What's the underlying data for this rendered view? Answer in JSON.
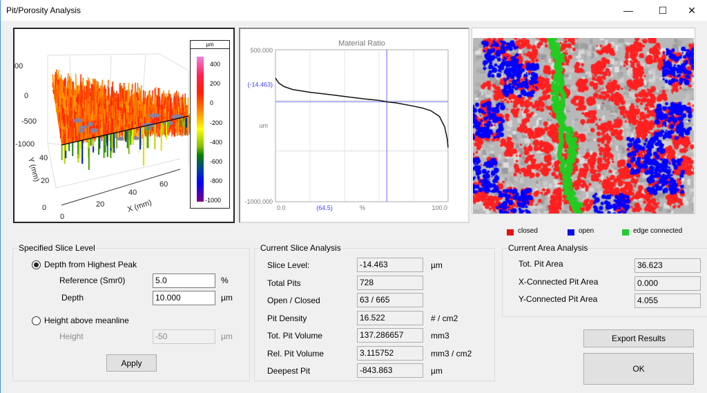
{
  "window": {
    "title": "Pit/Porosity Analysis",
    "minimize": "—",
    "maximize": "☐",
    "close": "✕"
  },
  "surface3d": {
    "colorbar_unit": "µm",
    "colorbar_ticks": [
      "400",
      "200",
      "0",
      "-200",
      "-400",
      "-600",
      "-800",
      "-1000"
    ],
    "z_ticks": [
      "00",
      "0",
      "-500",
      "-1000"
    ],
    "y_ticks": [
      "40",
      "20",
      "0"
    ],
    "x_ticks": [
      "0",
      "20",
      "40",
      "60"
    ],
    "x_label": "X (mm)",
    "y_label": "Y (mm)"
  },
  "chart_data": {
    "type": "line",
    "title": "Material Ratio",
    "xlabel": "%",
    "ylabel": "um",
    "xlim": [
      0,
      100
    ],
    "ylim": [
      -1000,
      500
    ],
    "x_tick_labels": [
      "0.0",
      "100.0"
    ],
    "y_tick_labels": [
      "500.000",
      "-1000.000"
    ],
    "grid": true,
    "slice_level_label": "(-14.463)",
    "slice_level": -14.463,
    "ratio_marker_label": "(64.5)",
    "ratio_marker": 64.5,
    "series": [
      {
        "x": [
          0,
          2,
          5,
          10,
          20,
          30,
          40,
          50,
          60,
          64.5,
          70,
          80,
          85,
          90,
          95,
          98,
          99.5,
          100
        ],
        "y": [
          220,
          170,
          136,
          107,
          80,
          60,
          39,
          18,
          0,
          -14.5,
          -25,
          -57,
          -75,
          -102,
          -159,
          -261,
          -380,
          -466
        ]
      }
    ]
  },
  "pit_map": {
    "colors": {
      "closed": "#ff2020",
      "open": "#0000ff",
      "edge": "#22cc22"
    }
  },
  "legend": [
    {
      "label": "closed",
      "color": "#e81010"
    },
    {
      "label": "open",
      "color": "#0010f0"
    },
    {
      "label": "edge connected",
      "color": "#22cc33"
    }
  ],
  "slice_level": {
    "title": "Specified Slice Level",
    "opt1": "Depth from Highest Peak",
    "opt1_selected": true,
    "ref_label": "Reference (Smr0)",
    "ref_value": "5.0",
    "ref_unit": "%",
    "depth_label": "Depth",
    "depth_value": "10.000",
    "depth_unit": "µm",
    "opt2": "Height above meanline",
    "height_label": "Height",
    "height_value": "-50",
    "height_unit": "µm",
    "apply": "Apply"
  },
  "slice_analysis": {
    "title": "Current Slice Analysis",
    "rows": [
      {
        "label": "Slice Level:",
        "value": "-14.463",
        "unit": "µm"
      },
      {
        "label": "Total Pits",
        "value": "728",
        "unit": ""
      },
      {
        "label": "Open / Closed",
        "value": "63   /   665",
        "unit": ""
      },
      {
        "label": "Pit Density",
        "value": "16.522",
        "unit": "# / cm2"
      },
      {
        "label": "Tot. Pit Volume",
        "value": "137.286657",
        "unit": "mm3"
      },
      {
        "label": "Rel. Pit Volume",
        "value": "3.115752",
        "unit": "mm3 / cm2"
      },
      {
        "label": "Deepest Pit",
        "value": "-843.863",
        "unit": "µm"
      }
    ]
  },
  "area_analysis": {
    "title": "Current Area Analysis",
    "rows": [
      {
        "label": "Tot. Pit Area",
        "value": "36.623"
      },
      {
        "label": "X-Connected Pit Area",
        "value": "0.000"
      },
      {
        "label": "Y-Connected Pit Area",
        "value": "4.055"
      }
    ]
  },
  "buttons": {
    "export": "Export Results",
    "ok": "OK"
  }
}
